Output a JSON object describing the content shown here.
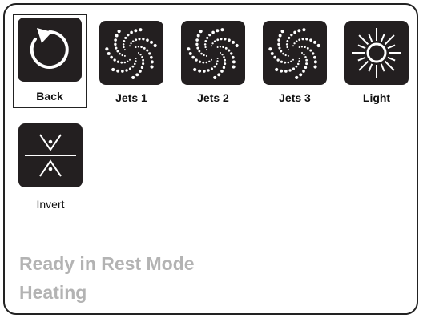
{
  "buttons": {
    "back": "Back",
    "jets1": "Jets 1",
    "jets2": "Jets 2",
    "jets3": "Jets 3",
    "light": "Light",
    "invert": "Invert"
  },
  "status": {
    "line1": "Ready in Rest Mode",
    "line2": "Heating"
  },
  "icons": {
    "back": "rotate-back-icon",
    "jets": "jets-swirl-icon",
    "light": "sun-icon",
    "invert": "invert-icon"
  },
  "colors": {
    "tile": "#231f20",
    "status_text": "#b3b3b3"
  }
}
